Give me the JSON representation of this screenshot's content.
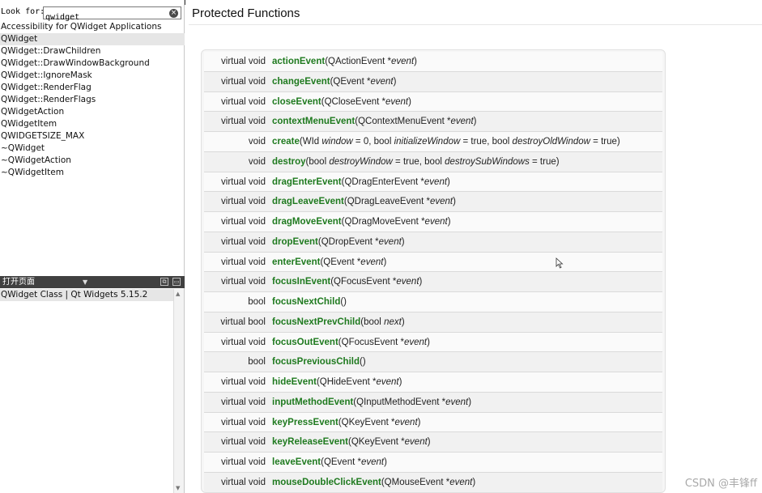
{
  "search": {
    "label": "Look for:",
    "value": "qwidget"
  },
  "index_items": [
    "Accessibility for QWidget Applications",
    "QWidget",
    "QWidget::DrawChildren",
    "QWidget::DrawWindowBackground",
    "QWidget::IgnoreMask",
    "QWidget::RenderFlag",
    "QWidget::RenderFlags",
    "QWidgetAction",
    "QWidgetItem",
    "QWIDGETSIZE_MAX",
    "~QWidget",
    "~QWidgetAction",
    "~QWidgetItem"
  ],
  "index_selected": 1,
  "open_pages": {
    "title": "打开页面",
    "items": [
      "QWidget Class | Qt Widgets 5.15.2"
    ]
  },
  "content": {
    "title": "Protected Functions",
    "functions": [
      {
        "ret": "virtual void",
        "name": "actionEvent",
        "args": "(QActionEvent *<i>event</i>)"
      },
      {
        "ret": "virtual void",
        "name": "changeEvent",
        "args": "(QEvent *<i>event</i>)"
      },
      {
        "ret": "virtual void",
        "name": "closeEvent",
        "args": "(QCloseEvent *<i>event</i>)"
      },
      {
        "ret": "virtual void",
        "name": "contextMenuEvent",
        "args": "(QContextMenuEvent *<i>event</i>)"
      },
      {
        "ret": "void",
        "name": "create",
        "args": "(WId <i>window</i> = 0, bool <i>initializeWindow</i> = true, bool <i>destroyOldWindow</i> = true)"
      },
      {
        "ret": "void",
        "name": "destroy",
        "args": "(bool <i>destroyWindow</i> = true, bool <i>destroySubWindows</i> = true)"
      },
      {
        "ret": "virtual void",
        "name": "dragEnterEvent",
        "args": "(QDragEnterEvent *<i>event</i>)"
      },
      {
        "ret": "virtual void",
        "name": "dragLeaveEvent",
        "args": "(QDragLeaveEvent *<i>event</i>)"
      },
      {
        "ret": "virtual void",
        "name": "dragMoveEvent",
        "args": "(QDragMoveEvent *<i>event</i>)"
      },
      {
        "ret": "virtual void",
        "name": "dropEvent",
        "args": "(QDropEvent *<i>event</i>)"
      },
      {
        "ret": "virtual void",
        "name": "enterEvent",
        "args": "(QEvent *<i>event</i>)"
      },
      {
        "ret": "virtual void",
        "name": "focusInEvent",
        "args": "(QFocusEvent *<i>event</i>)"
      },
      {
        "ret": "bool",
        "name": "focusNextChild",
        "args": "()"
      },
      {
        "ret": "virtual bool",
        "name": "focusNextPrevChild",
        "args": "(bool <i>next</i>)"
      },
      {
        "ret": "virtual void",
        "name": "focusOutEvent",
        "args": "(QFocusEvent *<i>event</i>)"
      },
      {
        "ret": "bool",
        "name": "focusPreviousChild",
        "args": "()"
      },
      {
        "ret": "virtual void",
        "name": "hideEvent",
        "args": "(QHideEvent *<i>event</i>)"
      },
      {
        "ret": "virtual void",
        "name": "inputMethodEvent",
        "args": "(QInputMethodEvent *<i>event</i>)"
      },
      {
        "ret": "virtual void",
        "name": "keyPressEvent",
        "args": "(QKeyEvent *<i>event</i>)"
      },
      {
        "ret": "virtual void",
        "name": "keyReleaseEvent",
        "args": "(QKeyEvent *<i>event</i>)"
      },
      {
        "ret": "virtual void",
        "name": "leaveEvent",
        "args": "(QEvent *<i>event</i>)"
      },
      {
        "ret": "virtual void",
        "name": "mouseDoubleClickEvent",
        "args": "(QMouseEvent *<i>event</i>)"
      }
    ]
  },
  "watermark": "CSDN @丰锋ff",
  "colors": {
    "function_name": "#1f7a1f",
    "header_bar": "#404040",
    "selection": "#e6e6e6"
  }
}
